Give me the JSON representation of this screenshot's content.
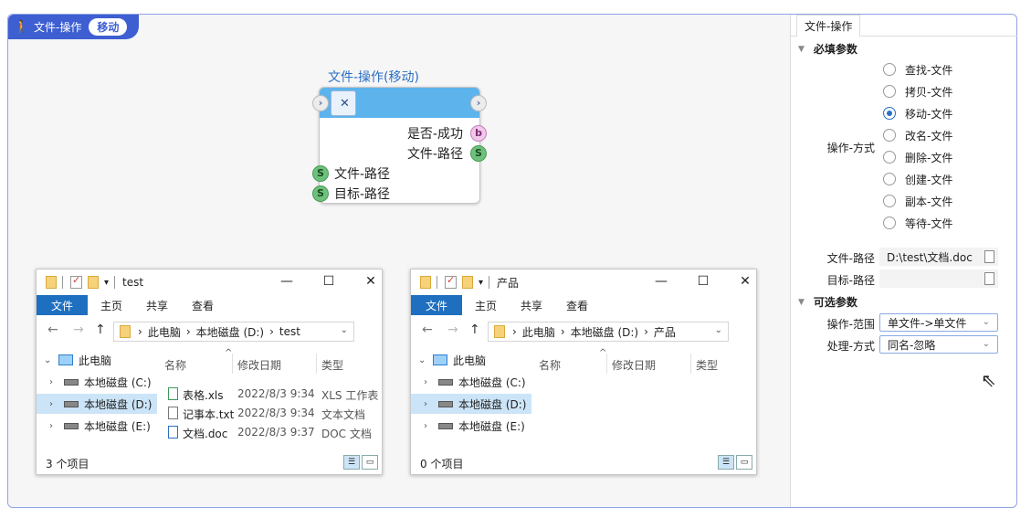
{
  "badge": {
    "title": "文件-操作",
    "mode": "移动"
  },
  "node": {
    "title": "文件-操作(移动)",
    "outputs": [
      {
        "label": "是否-成功",
        "type": "b"
      },
      {
        "label": "文件-路径",
        "type": "S"
      }
    ],
    "inputs": [
      {
        "label": "文件-路径",
        "type": "S"
      },
      {
        "label": "目标-路径",
        "type": "S"
      }
    ]
  },
  "explorer_left": {
    "title": "test",
    "tabs": [
      "文件",
      "主页",
      "共享",
      "查看"
    ],
    "breadcrumb": [
      "此电脑",
      "本地磁盘 (D:)",
      "test"
    ],
    "tree": [
      "此电脑",
      "本地磁盘 (C:)",
      "本地磁盘 (D:)",
      "本地磁盘 (E:)"
    ],
    "columns": [
      "名称",
      "修改日期",
      "类型"
    ],
    "files": [
      {
        "name": "表格.xls",
        "date": "2022/8/3 9:34",
        "type": "XLS 工作表"
      },
      {
        "name": "记事本.txt",
        "date": "2022/8/3 9:34",
        "type": "文本文档"
      },
      {
        "name": "文档.doc",
        "date": "2022/8/3 9:37",
        "type": "DOC 文档"
      }
    ],
    "status": "3 个项目"
  },
  "explorer_right": {
    "title": "产品",
    "tabs": [
      "文件",
      "主页",
      "共享",
      "查看"
    ],
    "breadcrumb": [
      "此电脑",
      "本地磁盘 (D:)",
      "产品"
    ],
    "tree": [
      "此电脑",
      "本地磁盘 (C:)",
      "本地磁盘 (D:)",
      "本地磁盘 (E:)"
    ],
    "columns": [
      "名称",
      "修改日期",
      "类型"
    ],
    "status": "0 个项目"
  },
  "panel": {
    "tab": "文件-操作",
    "required_title": "必填参数",
    "operation_label": "操作-方式",
    "operations": [
      "查找-文件",
      "拷贝-文件",
      "移动-文件",
      "改名-文件",
      "删除-文件",
      "创建-文件",
      "副本-文件",
      "等待-文件"
    ],
    "selected_operation": "移动-文件",
    "file_path_label": "文件-路径",
    "file_path_value": "D:\\test\\文档.doc",
    "target_path_label": "目标-路径",
    "target_path_value": "",
    "optional_title": "可选参数",
    "scope_label": "操作-范围",
    "scope_value": "单文件->单文件",
    "handling_label": "处理-方式",
    "handling_value": "同名-忽略"
  },
  "colors": {
    "accent": "#3d5fd1",
    "node_header": "#5db3ec",
    "ribbon_active": "#1e6fbf"
  }
}
